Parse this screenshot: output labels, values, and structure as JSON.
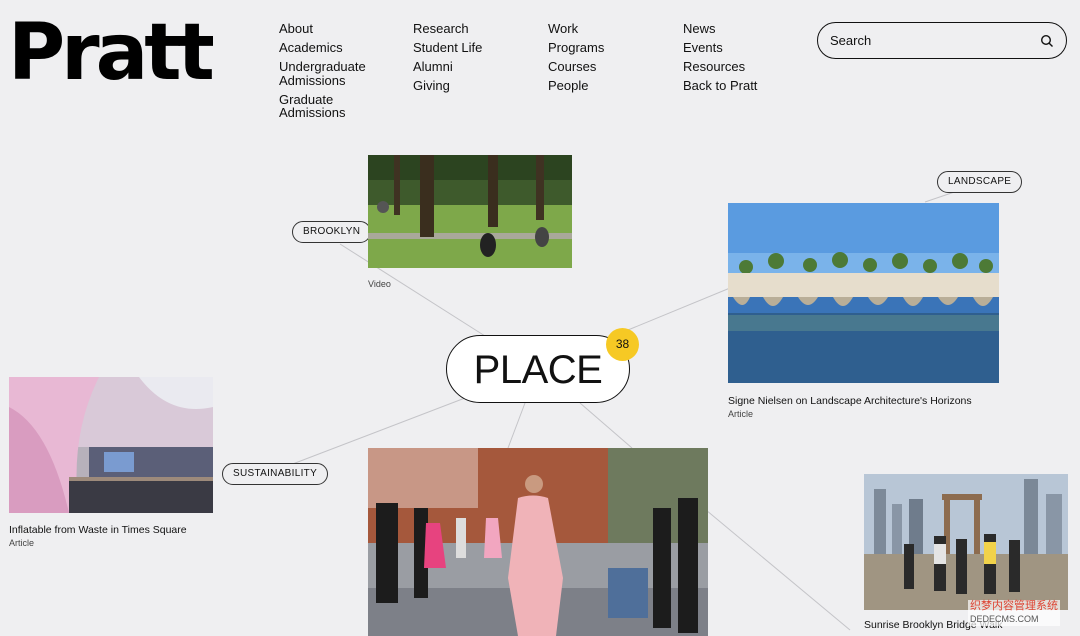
{
  "logo": "Pratt",
  "nav": {
    "col1": [
      "About",
      "Academics",
      "Undergraduate Admissions",
      "Graduate Admissions"
    ],
    "col2": [
      "Research",
      "Student Life",
      "Alumni",
      "Giving"
    ],
    "col3": [
      "Work",
      "Programs",
      "Courses",
      "People"
    ],
    "col4": [
      "News",
      "Events",
      "Resources",
      "Back to Pratt"
    ]
  },
  "search": {
    "placeholder": "Search",
    "icon": "search-icon"
  },
  "hub": {
    "label": "PLACE",
    "count": "38",
    "badge_color": "#f6c924"
  },
  "tags": {
    "brooklyn": "BROOKLYN",
    "landscape": "LANDSCAPE",
    "sustainability": "SUSTAINABILITY"
  },
  "cards": {
    "park": {
      "type": "Video"
    },
    "landscape": {
      "title": "Signe Nielsen on Landscape Architecture's Horizons",
      "type": "Article"
    },
    "inflatable": {
      "title": "Inflatable from Waste in Times Square",
      "type": "Article"
    },
    "bridge": {
      "title": "Sunrise Brooklyn Bridge Walk"
    }
  },
  "watermark": {
    "line1": "织梦内容管理系统",
    "line2": "DEDECMS.COM"
  }
}
